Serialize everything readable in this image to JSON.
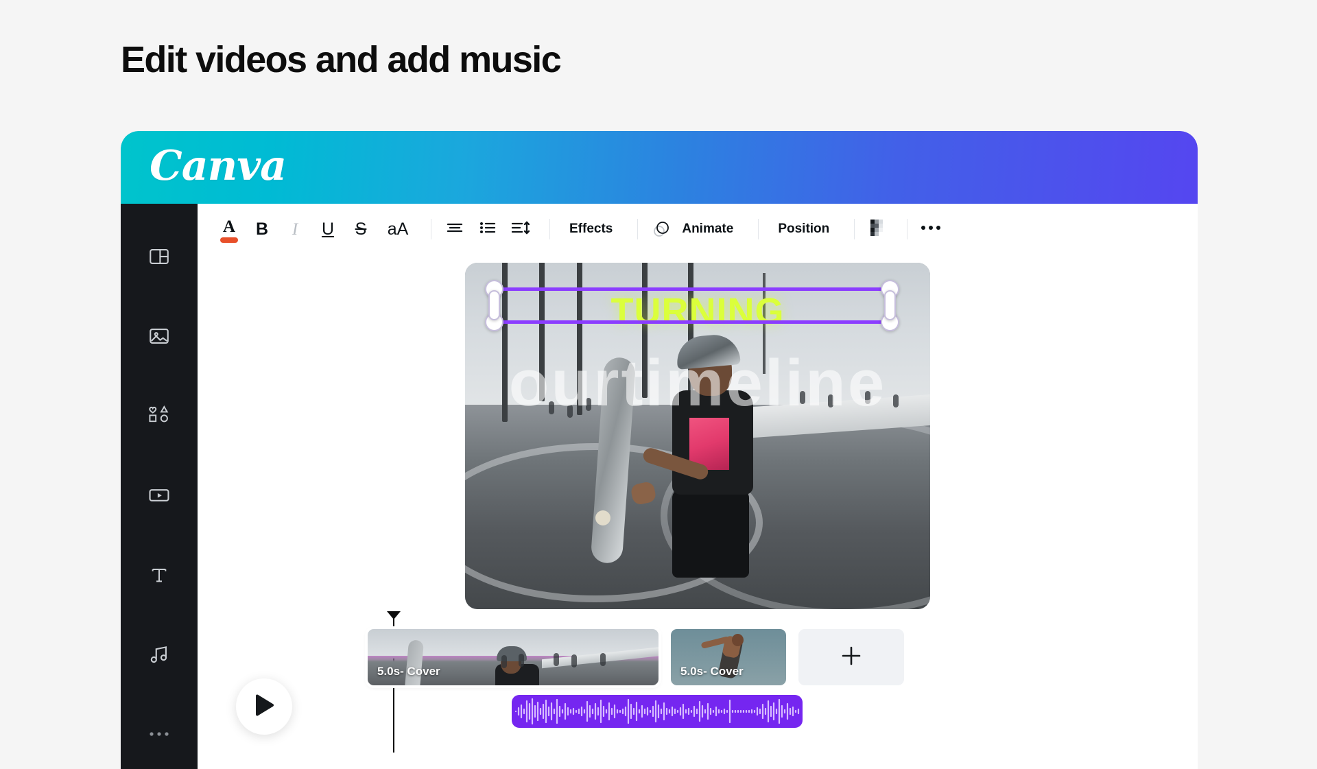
{
  "page": {
    "heading": "Edit videos and add music",
    "background_color": "#F5F5F5"
  },
  "brand": {
    "logo_text": "Canva",
    "gradient_start": "#00C4CC",
    "gradient_end": "#5546F0"
  },
  "sidebar": {
    "background_color": "#16181C",
    "items": [
      {
        "name": "design-templates",
        "icon": "layout-icon"
      },
      {
        "name": "uploads-images",
        "icon": "image-icon"
      },
      {
        "name": "elements",
        "icon": "shapes-icon"
      },
      {
        "name": "videos",
        "icon": "video-icon"
      },
      {
        "name": "text",
        "icon": "text-icon"
      },
      {
        "name": "audio",
        "icon": "music-note-icon"
      },
      {
        "name": "more-apps",
        "icon": "more-horizontal-icon"
      }
    ]
  },
  "toolbar": {
    "text_color_label": "A",
    "text_color_swatch": "#E8502A",
    "bold_label": "B",
    "italic_label": "I",
    "underline_label": "U",
    "strikethrough_label": "S",
    "case_label": "aA",
    "effects_label": "Effects",
    "animate_label": "Animate",
    "position_label": "Position",
    "icons": {
      "align": "align-text-icon",
      "list": "bulleted-list-icon",
      "spacing": "line-spacing-icon",
      "animate": "animate-circles-icon",
      "transparency": "transparency-checkerboard-icon",
      "more": "more-horizontal-icon"
    },
    "more_label": "•••"
  },
  "canvas": {
    "overlay_text": "TURNING",
    "overlay_text_color": "#DBFF3B",
    "watermark_text": "ourtimeline",
    "selection_color": "#8B3DFF",
    "handle_fill": "#FFFFFF"
  },
  "timeline": {
    "play_icon": "play-triangle-icon",
    "playhead_icon": "playhead-marker-icon",
    "add_label": "+",
    "clips": [
      {
        "label": "5.0s- Cover",
        "selected": true
      },
      {
        "label": "5.0s- Cover",
        "selected": false
      }
    ],
    "audio": {
      "track_color": "#7526F0",
      "wave_color": "#D8BCFF"
    }
  }
}
